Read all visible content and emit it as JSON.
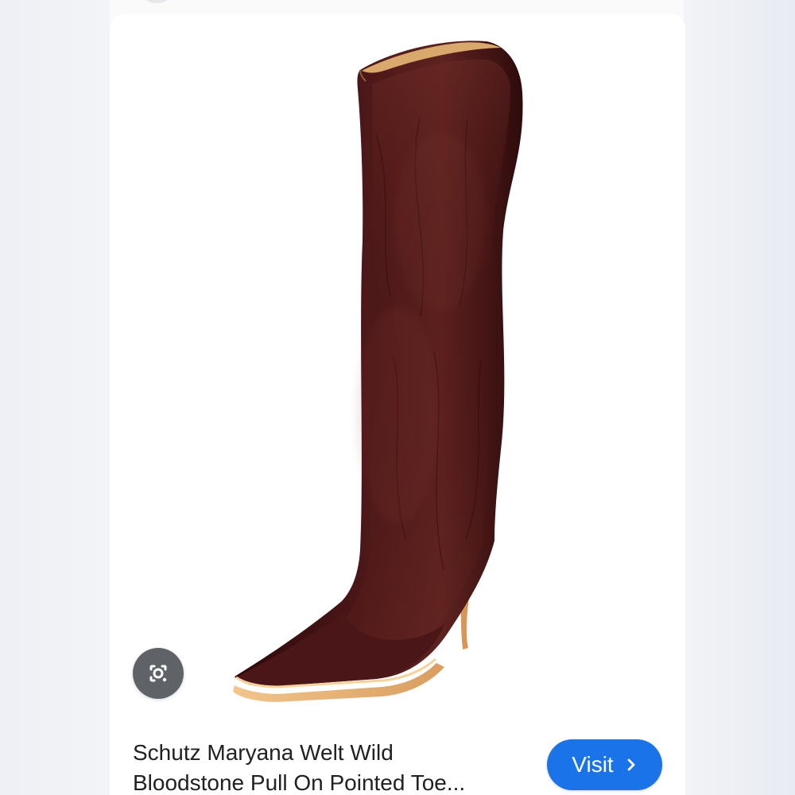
{
  "screen": {
    "background": "#fafafa",
    "card_background": "#ffffff",
    "accent": "#1a73e8"
  },
  "image": {
    "name": "knee-high-pointed-toe-boot",
    "colors": {
      "boot": "#3b0f10",
      "boot_highlight": "#6a2a24",
      "sole": "#e7b77a",
      "lining": "#d8a86d"
    }
  },
  "lens": {
    "icon": "google-lens-icon",
    "color": "#5f6368"
  },
  "product": {
    "title_line_1": "Schutz Maryana Welt Wild",
    "title_line_2": "Bloodstone Pull On Pointed Toe..."
  },
  "visit_button": {
    "label": "Visit",
    "icon": "chevron-right-icon"
  }
}
